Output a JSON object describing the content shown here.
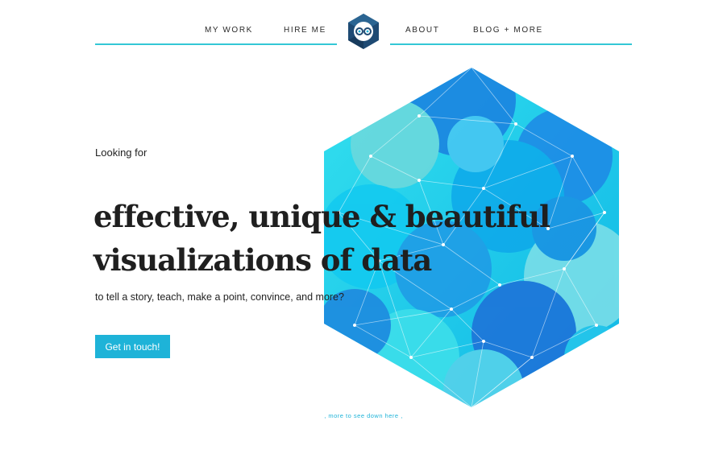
{
  "nav": {
    "items": [
      {
        "label": "MY WORK"
      },
      {
        "label": "HIRE ME"
      },
      {
        "label": "ABOUT"
      },
      {
        "label": "BLOG + MORE"
      }
    ],
    "accent_color": "#34c7d6"
  },
  "logo": {
    "icon": "infinity-eyes-hexagon-icon",
    "color": "#1e4a73"
  },
  "hero": {
    "lead": "Looking for",
    "headline_line1": "effective, unique & beautiful",
    "headline_line2": "visualizations of data",
    "subline": "to tell a story, teach, make a point, convince, and more?",
    "cta_label": "Get in touch!",
    "cta_color": "#1eb3d8",
    "graphic": "hexagon-network-graphic"
  },
  "footer_hint": {
    "text": "more to see down here"
  }
}
